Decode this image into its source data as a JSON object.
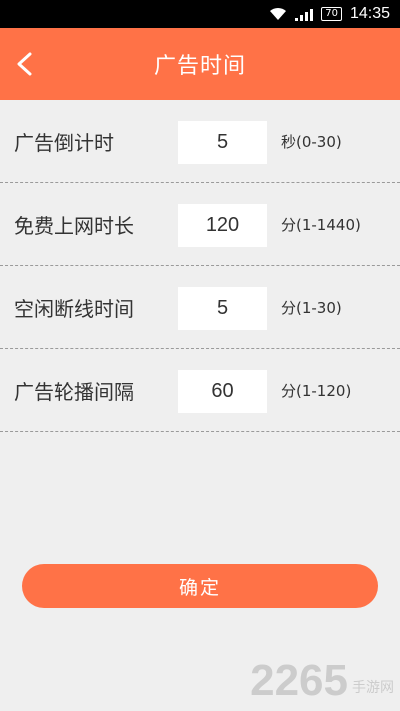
{
  "statusbar": {
    "battery": "70",
    "time": "14:35"
  },
  "header": {
    "title": "广告时间"
  },
  "settings": [
    {
      "label": "广告倒计时",
      "value": "5",
      "range": "秒(0-30)"
    },
    {
      "label": "免费上网时长",
      "value": "120",
      "range": "分(1-1440)"
    },
    {
      "label": "空闲断线时间",
      "value": "5",
      "range": "分(1-30)"
    },
    {
      "label": "广告轮播间隔",
      "value": "60",
      "range": "分(1-120)"
    }
  ],
  "confirm_label": "确定",
  "watermark": {
    "number": "2265",
    "text": "手游网"
  },
  "colors": {
    "accent": "#ff7247",
    "background": "#efefef"
  },
  "icons": {
    "back": "chevron-left-icon",
    "wifi": "wifi-icon",
    "signal": "signal-icon",
    "battery": "battery-icon"
  }
}
